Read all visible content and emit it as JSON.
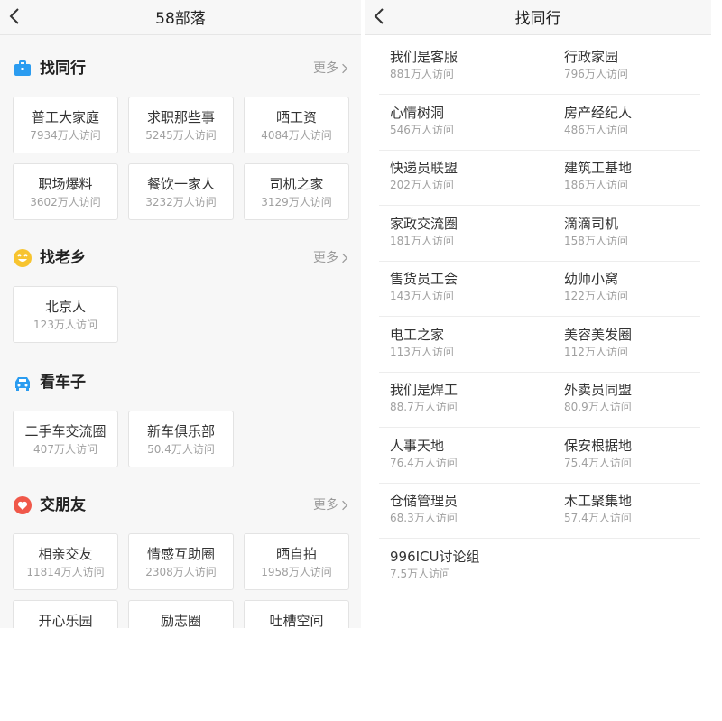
{
  "left": {
    "title": "58部落",
    "more_label": "更多",
    "sections": [
      {
        "title": "找同行",
        "icon": "briefcase-icon",
        "color": "#2b9cf0",
        "cards": [
          {
            "name": "普工大家庭",
            "visits": "7934万人访问"
          },
          {
            "name": "求职那些事",
            "visits": "5245万人访问"
          },
          {
            "name": "晒工资",
            "visits": "4084万人访问"
          },
          {
            "name": "职场爆料",
            "visits": "3602万人访问"
          },
          {
            "name": "餐饮一家人",
            "visits": "3232万人访问"
          },
          {
            "name": "司机之家",
            "visits": "3129万人访问"
          }
        ]
      },
      {
        "title": "找老乡",
        "icon": "smiley-icon",
        "color": "#f7c42f",
        "cards": [
          {
            "name": "北京人",
            "visits": "123万人访问"
          }
        ]
      },
      {
        "title": "看车子",
        "icon": "car-icon",
        "color": "#2b9cf0",
        "cards": [
          {
            "name": "二手车交流圈",
            "visits": "407万人访问"
          },
          {
            "name": "新车俱乐部",
            "visits": "50.4万人访问"
          }
        ]
      },
      {
        "title": "交朋友",
        "icon": "heart-icon",
        "color": "#f0584a",
        "cards": [
          {
            "name": "相亲交友",
            "visits": "11814万人访问"
          },
          {
            "name": "情感互助圈",
            "visits": "2308万人访问"
          },
          {
            "name": "晒自拍",
            "visits": "1958万人访问"
          },
          {
            "name": "开心乐园",
            "visits": ""
          },
          {
            "name": "励志圈",
            "visits": ""
          },
          {
            "name": "吐槽空间",
            "visits": ""
          }
        ]
      }
    ]
  },
  "right": {
    "title": "找同行",
    "items": [
      {
        "name": "我们是客服",
        "visits": "881万人访问"
      },
      {
        "name": "行政家园",
        "visits": "796万人访问"
      },
      {
        "name": "心情树洞",
        "visits": "546万人访问"
      },
      {
        "name": "房产经纪人",
        "visits": "486万人访问"
      },
      {
        "name": "快递员联盟",
        "visits": "202万人访问"
      },
      {
        "name": "建筑工基地",
        "visits": "186万人访问"
      },
      {
        "name": "家政交流圈",
        "visits": "181万人访问"
      },
      {
        "name": "滴滴司机",
        "visits": "158万人访问"
      },
      {
        "name": "售货员工会",
        "visits": "143万人访问"
      },
      {
        "name": "幼师小窝",
        "visits": "122万人访问"
      },
      {
        "name": "电工之家",
        "visits": "113万人访问"
      },
      {
        "name": "美容美发圈",
        "visits": "112万人访问"
      },
      {
        "name": "我们是焊工",
        "visits": "88.7万人访问"
      },
      {
        "name": "外卖员同盟",
        "visits": "80.9万人访问"
      },
      {
        "name": "人事天地",
        "visits": "76.4万人访问"
      },
      {
        "name": "保安根据地",
        "visits": "75.4万人访问"
      },
      {
        "name": "仓储管理员",
        "visits": "68.3万人访问"
      },
      {
        "name": "木工聚集地",
        "visits": "57.4万人访问"
      },
      {
        "name": "996ICU讨论组",
        "visits": "7.5万人访问"
      }
    ]
  }
}
